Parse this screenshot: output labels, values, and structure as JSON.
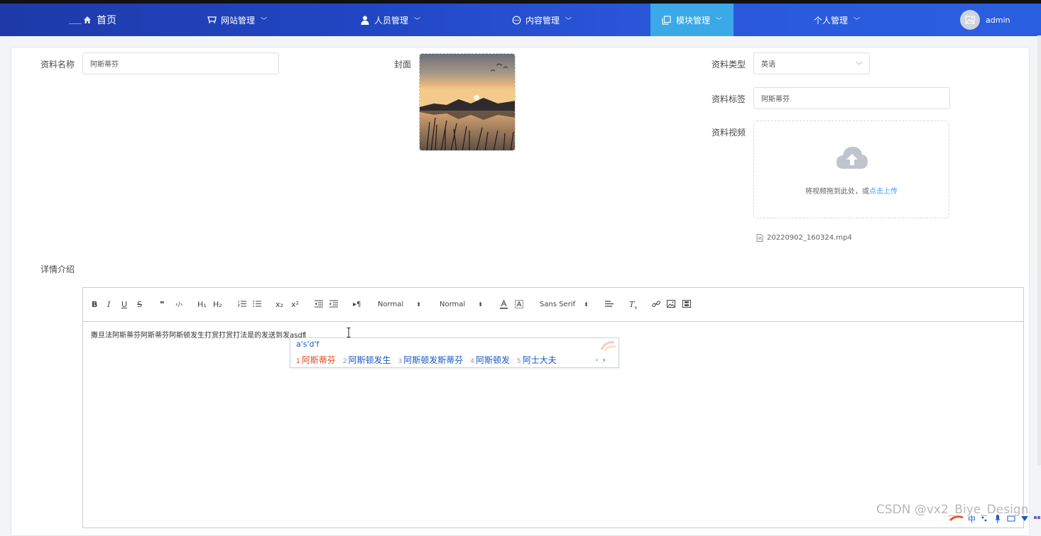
{
  "nav": {
    "home": "首页",
    "website": "网站管理",
    "people": "人员管理",
    "content": "内容管理",
    "module": "模块管理",
    "personal": "个人管理",
    "user": "admin"
  },
  "form": {
    "name_label": "资料名称",
    "name_value": "阿斯蒂芬",
    "cover_label": "封面",
    "type_label": "资料类型",
    "type_value": "英语",
    "tag_label": "资料标签",
    "tag_value": "阿斯蒂芬",
    "video_label": "资料视频",
    "upload_hint": "将视频拖到此处，或",
    "upload_link": "点击上传",
    "file_name": "20220902_160324.mp4",
    "detail_label": "详情介绍"
  },
  "editor": {
    "toolbar": {
      "bold": "B",
      "italic": "I",
      "underline": "U",
      "strike": "S",
      "quote": "❞",
      "code": "‹/›",
      "h1": "H₁",
      "h2": "H₂",
      "subscript": "x₂",
      "superscript": "x²",
      "direction": "▸¶",
      "size_select": "Normal",
      "header_select": "Normal",
      "font_select": "Sans Serif"
    },
    "content": "撒旦法阿斯蒂芬阿斯蒂芬阿斯顿发生打赏打赏打法是的发送到发asdf"
  },
  "ime": {
    "input": "a's'd'f",
    "candidates": [
      {
        "num": "1",
        "text": "阿斯蒂芬"
      },
      {
        "num": "2",
        "text": "阿斯顿发生"
      },
      {
        "num": "3",
        "text": "阿斯顿发斯蒂芬"
      },
      {
        "num": "4",
        "text": "阿斯顿发"
      },
      {
        "num": "5",
        "text": "阿士大夫"
      }
    ],
    "prev": "‹",
    "next": "›"
  },
  "watermark": "CSDN @vx2_Biye_Design",
  "colors": {
    "nav_start": "#1e3aa8",
    "nav_end": "#2a5ee0",
    "nav_active": "#3ba8e8",
    "link": "#409eff",
    "ime_blue": "#1a58c4",
    "ime_first": "#e04b1a"
  }
}
